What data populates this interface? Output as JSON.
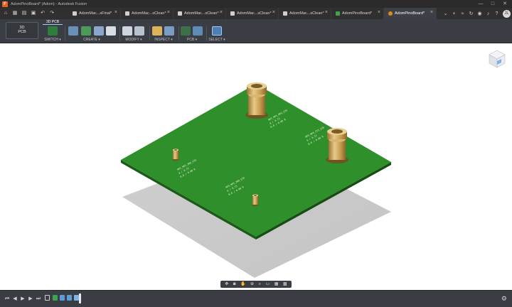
{
  "window": {
    "title": "AdomPinoBoard* (Adom) - Autodesk Fusion",
    "logo_letter": "F",
    "minimize": "—",
    "maximize": "□",
    "close": "✕"
  },
  "tabs": [
    {
      "label": "AdomMac...sFinal*",
      "icon": "document-icon",
      "active": false
    },
    {
      "label": "AdomMac...sClean*",
      "icon": "document-icon",
      "active": false
    },
    {
      "label": "AdomMac...sClean*",
      "icon": "document-icon",
      "active": false
    },
    {
      "label": "AdomMac...sClean*",
      "icon": "document-icon",
      "active": false
    },
    {
      "label": "AdomMac...sClean*",
      "icon": "document-icon",
      "active": false
    },
    {
      "label": "AdomPinoBoard*",
      "icon": "pcb-icon",
      "active": false
    },
    {
      "label": "AdomPinoBoard*",
      "icon": "board-icon",
      "active": true
    }
  ],
  "user": {
    "initials": "JL"
  },
  "ribbon": {
    "workspace_line1": "3D",
    "workspace_line2": "PCB",
    "active_tab": "3D PCB",
    "groups": [
      {
        "label": "SWITCH ▾"
      },
      {
        "label": "CREATE ▾"
      },
      {
        "label": "MODIFY ▾"
      },
      {
        "label": "INSPECT ▾"
      },
      {
        "label": "PCB ▾"
      },
      {
        "label": "SELECT ▾"
      }
    ]
  },
  "colors": {
    "pcb_green": "#2f8f2a",
    "pcb_edge": "#1f5e1c",
    "brass": "#c9a35b",
    "ribbon_bg": "#3a3d43",
    "accent": "#9ecbff"
  },
  "silkscreen": [
    "MP2_MP1_MP3_STD",
    "0 / 0.73",
    "0.0 / 0.00 R",
    "MP3_MP4_ST3_STD",
    "MP1_MP2_3RD_STD",
    "MP3_MP3_3RD_STD"
  ]
}
